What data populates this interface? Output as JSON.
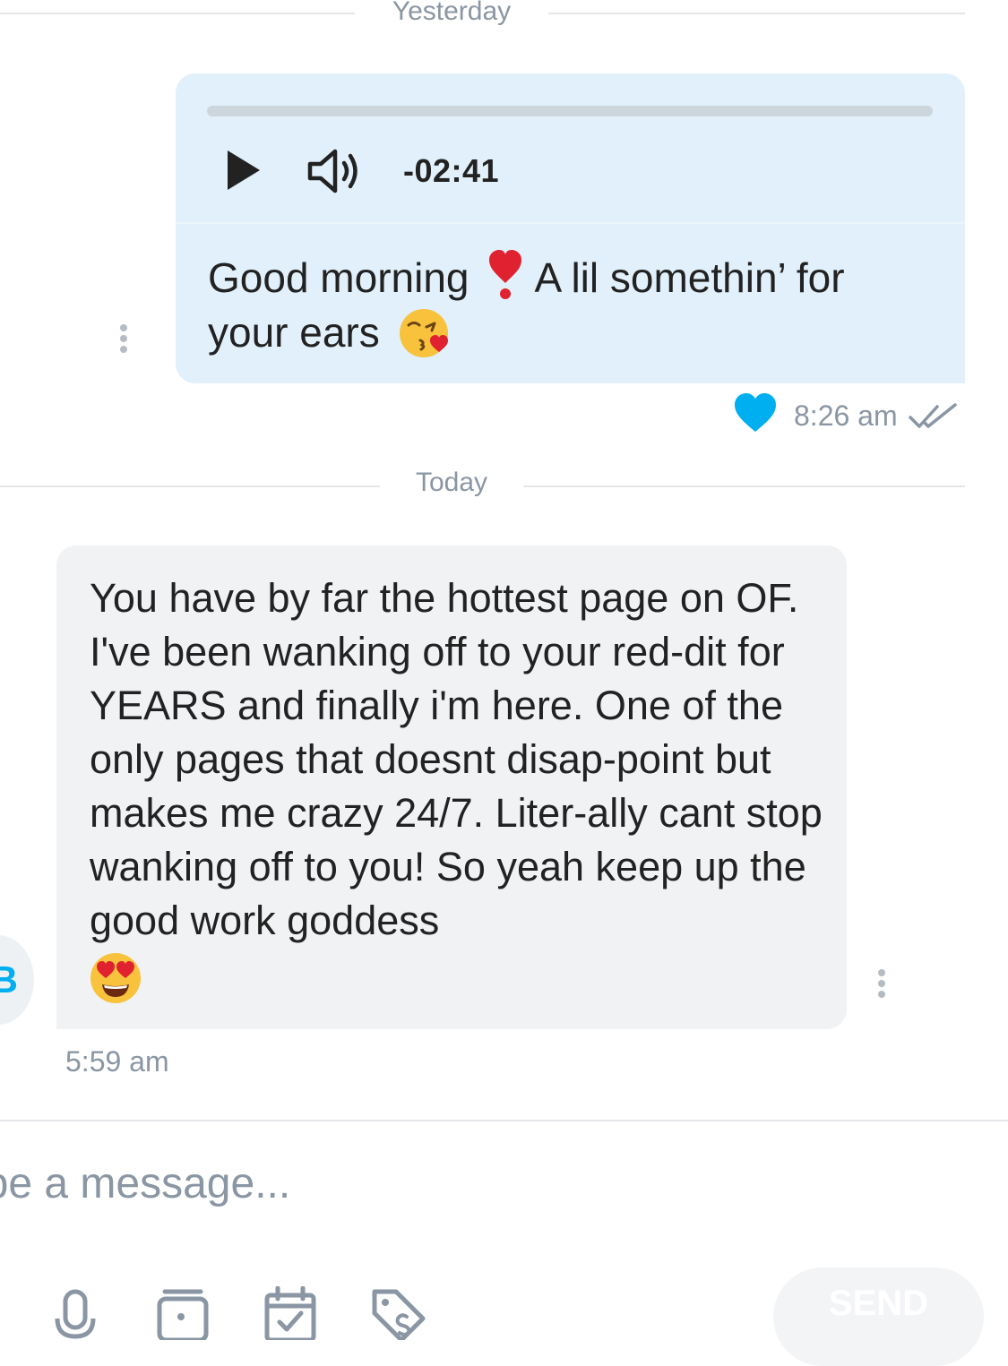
{
  "date_dividers": {
    "yesterday": "Yesterday",
    "today": "Today"
  },
  "outgoing_message": {
    "audio": {
      "remaining_time": "-02:41",
      "progress": 0
    },
    "text_part1": "Good morning",
    "text_part2": " A lil somethin’ for your ears",
    "emoji_1": "heart-exclamation",
    "emoji_2": "face-blowing-kiss",
    "time": "8:26 am",
    "liked": true,
    "status": "read"
  },
  "incoming_message": {
    "sender_initial": "B",
    "text": "You have by far the hottest page on OF. I've been wanking off to your red-dit for YEARS and finally i'm here. One of the only pages that doesnt disap-point but makes me crazy 24/7. Liter-ally cant stop wanking off to you! So yeah keep up the good work goddess",
    "emoji": "smiling-face-heart-eyes",
    "time": "5:59 am"
  },
  "composer": {
    "placeholder": "Type a message...",
    "send_label": "SEND",
    "tools": [
      "microphone-icon",
      "media-vault-icon",
      "schedule-icon",
      "price-tag-icon"
    ]
  },
  "colors": {
    "accent": "#00aff0",
    "outgoing_bubble": "#e1f0fa",
    "incoming_bubble": "#f0f2f4",
    "muted_text": "#8a96a3"
  }
}
